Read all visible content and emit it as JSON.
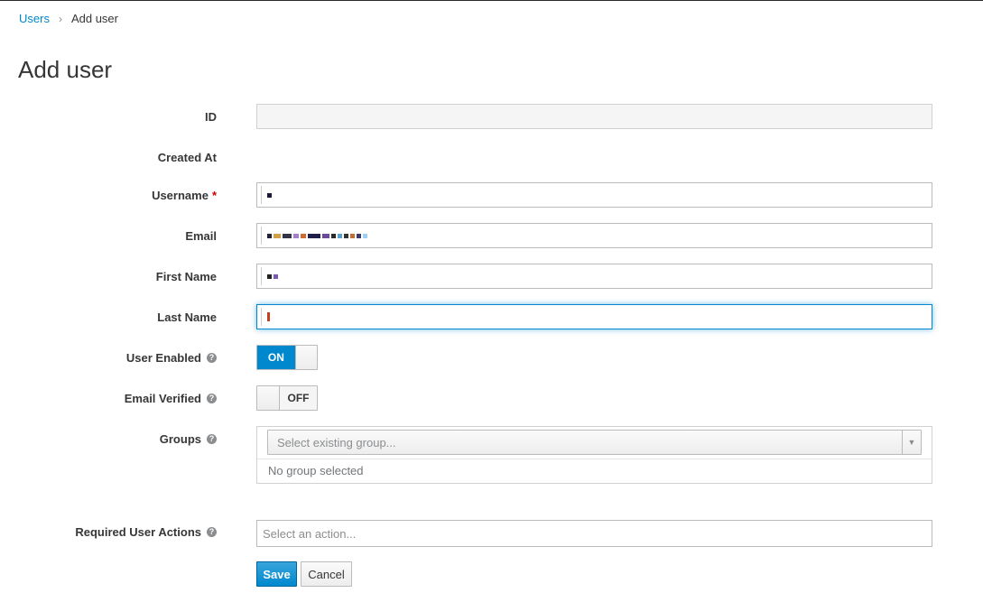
{
  "breadcrumb": {
    "parent": "Users",
    "separator": "›",
    "current": "Add user"
  },
  "page_title": "Add user",
  "form": {
    "id": {
      "label": "ID",
      "value": ""
    },
    "created_at": {
      "label": "Created At",
      "value": ""
    },
    "username": {
      "label": "Username",
      "required_mark": "*"
    },
    "email": {
      "label": "Email"
    },
    "first_name": {
      "label": "First Name"
    },
    "last_name": {
      "label": "Last Name"
    },
    "user_enabled": {
      "label": "User Enabled",
      "state": "ON"
    },
    "email_verified": {
      "label": "Email Verified",
      "state": "OFF"
    },
    "groups": {
      "label": "Groups",
      "placeholder": "Select existing group...",
      "empty_text": "No group selected"
    },
    "required_actions": {
      "label": "Required User Actions",
      "placeholder": "Select an action..."
    }
  },
  "buttons": {
    "save": "Save",
    "cancel": "Cancel"
  },
  "icons": {
    "help": "question-circle-icon",
    "caret": "caret-down-icon",
    "separator": "chevron-right-icon"
  },
  "colors": {
    "accent": "#0088ce",
    "required": "#cc0000",
    "text": "#363636"
  }
}
